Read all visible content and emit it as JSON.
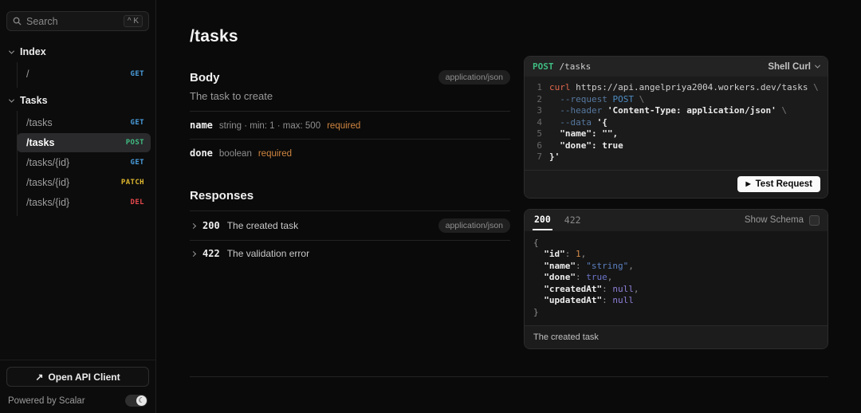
{
  "icons": {
    "open_api_client": "↗",
    "play": "▶",
    "moon": "☾"
  },
  "colors": {
    "background": "#0a0a0a",
    "panel_border": "#2d2d2d",
    "divider": "#232323",
    "method_get": "#4a9ede",
    "method_post": "#3fbc81",
    "method_patch": "#dfb72e",
    "method_del": "#e5484d",
    "required_orange": "#cf8540",
    "code_keyword": "#e0674d",
    "code_flag": "#56789f",
    "code_arg_blue": "#4e8cc2",
    "json_number": "#d08a4a",
    "json_string": "#5b7fc0",
    "json_bool": "#6b74c9",
    "json_null": "#8d80d8",
    "test_button_bg": "#fafafa"
  },
  "sidebar": {
    "search": {
      "placeholder": "Search",
      "shortcut": "^ K"
    },
    "sections": [
      {
        "label": "Index",
        "items": [
          {
            "path": "/",
            "method": "GET",
            "selected": false
          }
        ]
      },
      {
        "label": "Tasks",
        "items": [
          {
            "path": "/tasks",
            "method": "GET",
            "selected": false
          },
          {
            "path": "/tasks",
            "method": "POST",
            "selected": true
          },
          {
            "path": "/tasks/{id}",
            "method": "GET",
            "selected": false
          },
          {
            "path": "/tasks/{id}",
            "method": "PATCH",
            "selected": false
          },
          {
            "path": "/tasks/{id}",
            "method": "DEL",
            "selected": false
          }
        ]
      }
    ],
    "open_api_client_label": "Open API Client",
    "powered_by": "Powered by Scalar"
  },
  "main": {
    "title": "/tasks",
    "body_section": {
      "heading": "Body",
      "content_type_badge": "application/json",
      "description": "The task to create",
      "fields": [
        {
          "name": "name",
          "meta": "string · min: 1 · max: 500",
          "required": "required"
        },
        {
          "name": "done",
          "meta": "boolean",
          "required": "required"
        }
      ]
    },
    "responses_section": {
      "heading": "Responses",
      "items": [
        {
          "code": "200",
          "description": "The created task",
          "badge": "application/json"
        },
        {
          "code": "422",
          "description": "The validation error",
          "badge": ""
        }
      ]
    }
  },
  "request_example": {
    "method": "POST",
    "path": "/tasks",
    "client_selector": "Shell Curl",
    "test_request_label": "Test Request",
    "code_lines": [
      {
        "num": "1",
        "tokens": [
          {
            "c": "kw",
            "t": "curl"
          },
          {
            "c": "plain",
            "t": " https://api.angelpriya2004.workers.dev/tasks "
          },
          {
            "c": "esc",
            "t": "\\"
          }
        ]
      },
      {
        "num": "2",
        "tokens": [
          {
            "c": "flag",
            "t": "  --request "
          },
          {
            "c": "arg",
            "t": "POST"
          },
          {
            "c": "esc",
            "t": " \\"
          }
        ]
      },
      {
        "num": "3",
        "tokens": [
          {
            "c": "flag",
            "t": "  --header "
          },
          {
            "c": "str",
            "t": "'Content-Type: application/json'"
          },
          {
            "c": "esc",
            "t": " \\"
          }
        ]
      },
      {
        "num": "4",
        "tokens": [
          {
            "c": "flag",
            "t": "  --data "
          },
          {
            "c": "str",
            "t": "'{"
          }
        ]
      },
      {
        "num": "5",
        "tokens": [
          {
            "c": "str",
            "t": "  \"name\": \"\","
          }
        ]
      },
      {
        "num": "6",
        "tokens": [
          {
            "c": "str",
            "t": "  \"done\": true"
          }
        ]
      },
      {
        "num": "7",
        "tokens": [
          {
            "c": "str",
            "t": "}'"
          }
        ]
      }
    ]
  },
  "response_example": {
    "tabs": [
      "200",
      "422"
    ],
    "active_tab": "200",
    "show_schema_label": "Show Schema",
    "footer": "The created task",
    "json_lines": [
      [
        {
          "c": "punct",
          "t": "{"
        }
      ],
      [
        {
          "c": "key",
          "t": "  \"id\""
        },
        {
          "c": "punct",
          "t": ": "
        },
        {
          "c": "num",
          "t": "1"
        },
        {
          "c": "punct",
          "t": ","
        }
      ],
      [
        {
          "c": "key",
          "t": "  \"name\""
        },
        {
          "c": "punct",
          "t": ": "
        },
        {
          "c": "sval",
          "t": "\"string\""
        },
        {
          "c": "punct",
          "t": ","
        }
      ],
      [
        {
          "c": "key",
          "t": "  \"done\""
        },
        {
          "c": "punct",
          "t": ": "
        },
        {
          "c": "bool",
          "t": "true"
        },
        {
          "c": "punct",
          "t": ","
        }
      ],
      [
        {
          "c": "key",
          "t": "  \"createdAt\""
        },
        {
          "c": "punct",
          "t": ": "
        },
        {
          "c": "nul",
          "t": "null"
        },
        {
          "c": "punct",
          "t": ","
        }
      ],
      [
        {
          "c": "key",
          "t": "  \"updatedAt\""
        },
        {
          "c": "punct",
          "t": ": "
        },
        {
          "c": "nul",
          "t": "null"
        }
      ],
      [
        {
          "c": "punct",
          "t": "}"
        }
      ]
    ]
  }
}
